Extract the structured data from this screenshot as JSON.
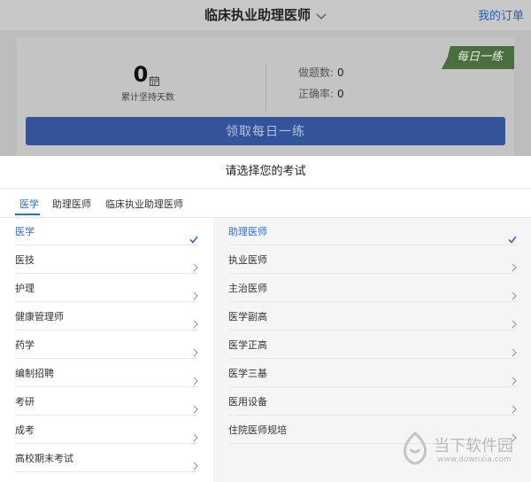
{
  "header": {
    "title": "临床执业助理医师",
    "my_orders": "我的订单"
  },
  "daily": {
    "streak_count": "0",
    "streak_label": "累计坚持天数",
    "done_label": "做题数:",
    "done_value": "0",
    "accuracy_label": "正确率:",
    "accuracy_value": "0",
    "ribbon_text": "每日一练",
    "claim_button": "领取每日一练"
  },
  "sheet": {
    "title": "请选择您的考试",
    "tabs": [
      {
        "label": "医学",
        "active": true
      },
      {
        "label": "助理医师",
        "active": false
      },
      {
        "label": "临床执业助理医师",
        "active": false
      }
    ],
    "left_items": [
      {
        "label": "医学",
        "active": true
      },
      {
        "label": "医技",
        "active": false
      },
      {
        "label": "护理",
        "active": false
      },
      {
        "label": "健康管理师",
        "active": false
      },
      {
        "label": "药学",
        "active": false
      },
      {
        "label": "编制招聘",
        "active": false
      },
      {
        "label": "考研",
        "active": false
      },
      {
        "label": "成考",
        "active": false
      },
      {
        "label": "高校期末考试",
        "active": false
      }
    ],
    "right_items": [
      {
        "label": "助理医师",
        "active": true
      },
      {
        "label": "执业医师",
        "active": false
      },
      {
        "label": "主治医师",
        "active": false
      },
      {
        "label": "医学副高",
        "active": false
      },
      {
        "label": "医学正高",
        "active": false
      },
      {
        "label": "医学三基",
        "active": false
      },
      {
        "label": "医用设备",
        "active": false
      },
      {
        "label": "住院医师规培",
        "active": false
      }
    ]
  },
  "watermark": {
    "name": "当下软件园",
    "url": "www.downxia.com"
  },
  "colors": {
    "accent": "#2a6fd6",
    "button": "#33549a",
    "ribbon": "#4a6e3f"
  }
}
